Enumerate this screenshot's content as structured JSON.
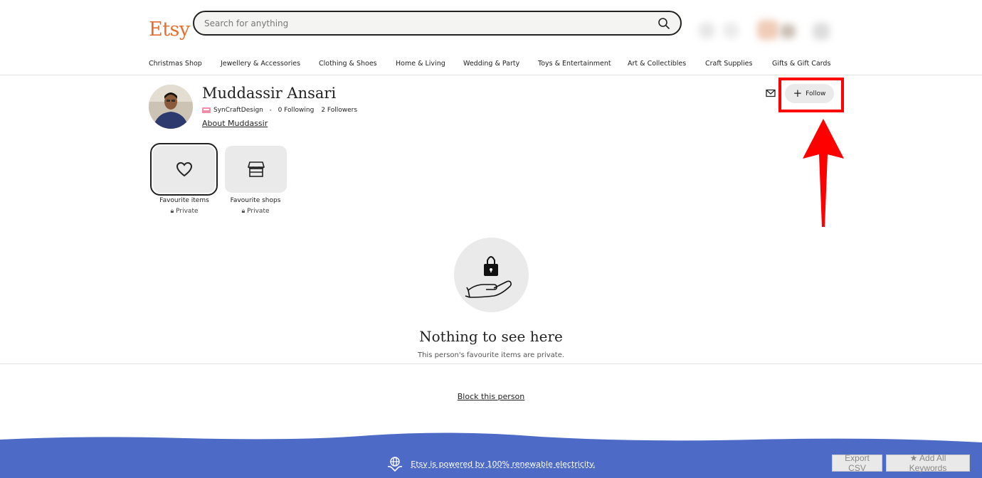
{
  "header": {
    "logo": "Etsy",
    "search_placeholder": "Search for anything"
  },
  "nav": {
    "items": [
      {
        "label": "Christmas Shop"
      },
      {
        "label": "Jewellery & Accessories"
      },
      {
        "label": "Clothing & Shoes"
      },
      {
        "label": "Home & Living"
      },
      {
        "label": "Wedding & Party"
      },
      {
        "label": "Toys & Entertainment"
      },
      {
        "label": "Art & Collectibles"
      },
      {
        "label": "Craft Supplies"
      },
      {
        "label": "Gifts & Gift Cards"
      }
    ]
  },
  "profile": {
    "name": "Muddassir Ansari",
    "shop": "SynCraftDesign",
    "following": "0 Following",
    "followers": "2 Followers",
    "about": "About Muddassir",
    "follow_label": "Follow"
  },
  "tabs": [
    {
      "label": "Favourite items",
      "privacy": "Private",
      "icon": "heart-icon"
    },
    {
      "label": "Favourite shops",
      "privacy": "Private",
      "icon": "shop-icon"
    }
  ],
  "empty_state": {
    "title": "Nothing to see here",
    "subtitle": "This person's favourite items are private."
  },
  "block_label": "Block this person",
  "footer": {
    "text": "Etsy is powered by 100% renewable electricity."
  },
  "extension": {
    "export_label": "Export CSV",
    "add_label": "★ Add All Keywords"
  },
  "colors": {
    "brand": "#e56f2e",
    "footer_blue": "#4d6bc6",
    "highlight": "#ff0000"
  }
}
